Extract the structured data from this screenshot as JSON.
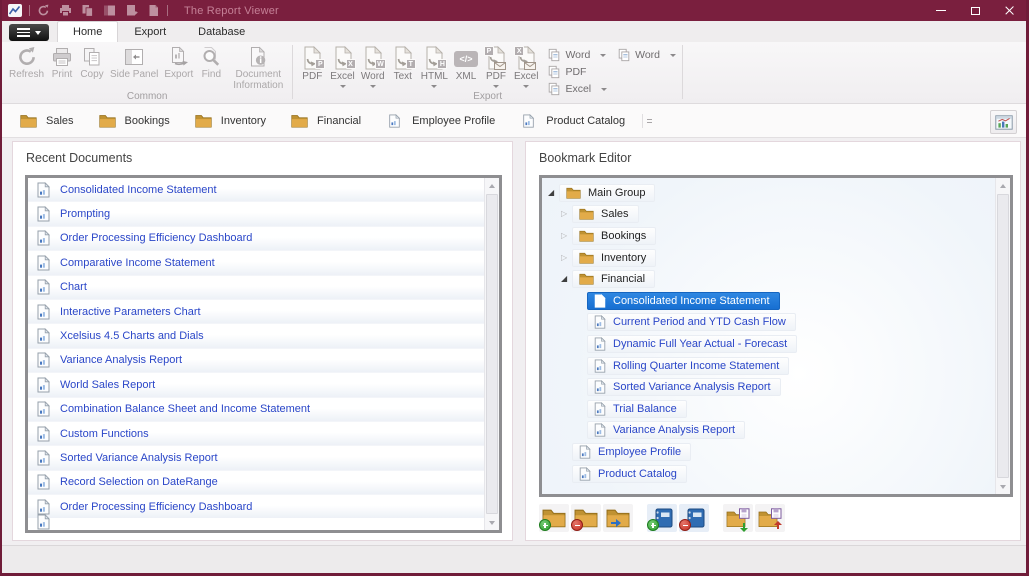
{
  "window": {
    "title": "The Report Viewer"
  },
  "ribbon": {
    "tabs": [
      {
        "label": "Home"
      },
      {
        "label": "Export"
      },
      {
        "label": "Database"
      }
    ],
    "active_tab": "Home",
    "common_group": {
      "label": "Common",
      "buttons": [
        {
          "name": "refresh",
          "label": "Refresh",
          "icon": "refresh"
        },
        {
          "name": "print",
          "label": "Print",
          "icon": "print"
        },
        {
          "name": "copy",
          "label": "Copy",
          "icon": "copy"
        },
        {
          "name": "side-panel",
          "label": "Side Panel",
          "icon": "side-panel"
        },
        {
          "name": "export",
          "label": "Export",
          "icon": "export"
        },
        {
          "name": "find",
          "label": "Find",
          "icon": "find"
        },
        {
          "name": "document-information",
          "label": "Document Information",
          "icon": "document-info"
        }
      ]
    },
    "export_group": {
      "label": "Export",
      "large_buttons": [
        {
          "name": "pdf",
          "label": "PDF",
          "badge": "P",
          "icon": "page",
          "dropdown": false
        },
        {
          "name": "excel",
          "label": "Excel",
          "badge": "X",
          "icon": "page",
          "dropdown": true
        },
        {
          "name": "word",
          "label": "Word",
          "badge": "W",
          "icon": "page",
          "dropdown": true
        },
        {
          "name": "text",
          "label": "Text",
          "badge": "T",
          "icon": "page",
          "dropdown": false
        },
        {
          "name": "html",
          "label": "HTML",
          "badge": "H",
          "icon": "page",
          "dropdown": true
        },
        {
          "name": "xml",
          "label": "XML",
          "badge": "</>",
          "icon": "xml",
          "dropdown": false
        },
        {
          "name": "pdf-email",
          "label": "PDF",
          "badge": "P",
          "icon": "page-mail",
          "dropdown": true
        },
        {
          "name": "excel-email",
          "label": "Excel",
          "badge": "X",
          "icon": "page-mail",
          "dropdown": true
        }
      ],
      "small_buttons_col1": [
        {
          "name": "word-2",
          "label": "Word",
          "dropdown": true
        },
        {
          "name": "pdf-2",
          "label": "PDF",
          "dropdown": false
        },
        {
          "name": "excel-2",
          "label": "Excel",
          "dropdown": true
        }
      ],
      "small_buttons_col2": [
        {
          "name": "word-3",
          "label": "Word",
          "dropdown": true
        }
      ]
    }
  },
  "folder_tabs": [
    {
      "name": "sales",
      "label": "Sales",
      "icon": "folder"
    },
    {
      "name": "bookings",
      "label": "Bookings",
      "icon": "folder"
    },
    {
      "name": "inventory",
      "label": "Inventory",
      "icon": "folder"
    },
    {
      "name": "financial",
      "label": "Financial",
      "icon": "folder"
    },
    {
      "name": "employee-profile",
      "label": "Employee Profile",
      "icon": "document"
    },
    {
      "name": "product-catalog",
      "label": "Product Catalog",
      "icon": "document"
    }
  ],
  "recent_documents": {
    "title": "Recent Documents",
    "items": [
      "Consolidated Income Statement",
      "Prompting",
      "Order Processing Efficiency Dashboard",
      "Comparative Income Statement",
      "Chart",
      "Interactive Parameters Chart",
      "Xcelsius 4.5 Charts and Dials",
      "Variance Analysis Report",
      "World Sales Report",
      "Combination Balance Sheet and Income Statement",
      "Custom Functions",
      "Sorted Variance Analysis Report",
      "Record Selection on DateRange",
      "Order Processing Efficiency Dashboard"
    ]
  },
  "bookmark_editor": {
    "title": "Bookmark Editor",
    "tree": [
      {
        "label": "Main Group",
        "level": 0,
        "icon": "folder",
        "expander": "expanded"
      },
      {
        "label": "Sales",
        "level": 1,
        "icon": "folder",
        "expander": "collapsed"
      },
      {
        "label": "Bookings",
        "level": 1,
        "icon": "folder",
        "expander": "collapsed"
      },
      {
        "label": "Inventory",
        "level": 1,
        "icon": "folder",
        "expander": "collapsed"
      },
      {
        "label": "Financial",
        "level": 1,
        "icon": "folder",
        "expander": "expanded"
      },
      {
        "label": "Consolidated Income Statement",
        "level": 2,
        "icon": "document",
        "selected": true
      },
      {
        "label": "Current Period and YTD Cash Flow",
        "level": 2,
        "icon": "document"
      },
      {
        "label": "Dynamic Full Year Actual - Forecast",
        "level": 2,
        "icon": "document"
      },
      {
        "label": "Rolling Quarter Income Statement",
        "level": 2,
        "icon": "document"
      },
      {
        "label": "Sorted Variance Analysis Report",
        "level": 2,
        "icon": "document"
      },
      {
        "label": "Trial Balance",
        "level": 2,
        "icon": "document"
      },
      {
        "label": "Variance Analysis Report",
        "level": 2,
        "icon": "document"
      },
      {
        "label": "Employee Profile",
        "level": 1,
        "icon": "document"
      },
      {
        "label": "Product Catalog",
        "level": 1,
        "icon": "document"
      }
    ],
    "toolbar": [
      {
        "name": "add-group",
        "base": "folder",
        "mark": "plus"
      },
      {
        "name": "remove-group",
        "base": "folder",
        "mark": "minus"
      },
      {
        "name": "move-group",
        "base": "folder",
        "mark": "arrow"
      },
      {
        "name": "add-bookmark",
        "base": "book",
        "mark": "plus"
      },
      {
        "name": "remove-bookmark",
        "base": "book",
        "mark": "minus"
      },
      {
        "name": "import-bookmarks",
        "base": "folder-save",
        "mark": "arrow-in"
      },
      {
        "name": "export-bookmarks",
        "base": "folder-save",
        "mark": "arrow-out"
      }
    ]
  },
  "colors": {
    "titlebar": "#7a1f3e",
    "selection_blue": "#1d79d9",
    "link_blue": "#2a46c8",
    "folder_tan": "#e2ab49"
  }
}
